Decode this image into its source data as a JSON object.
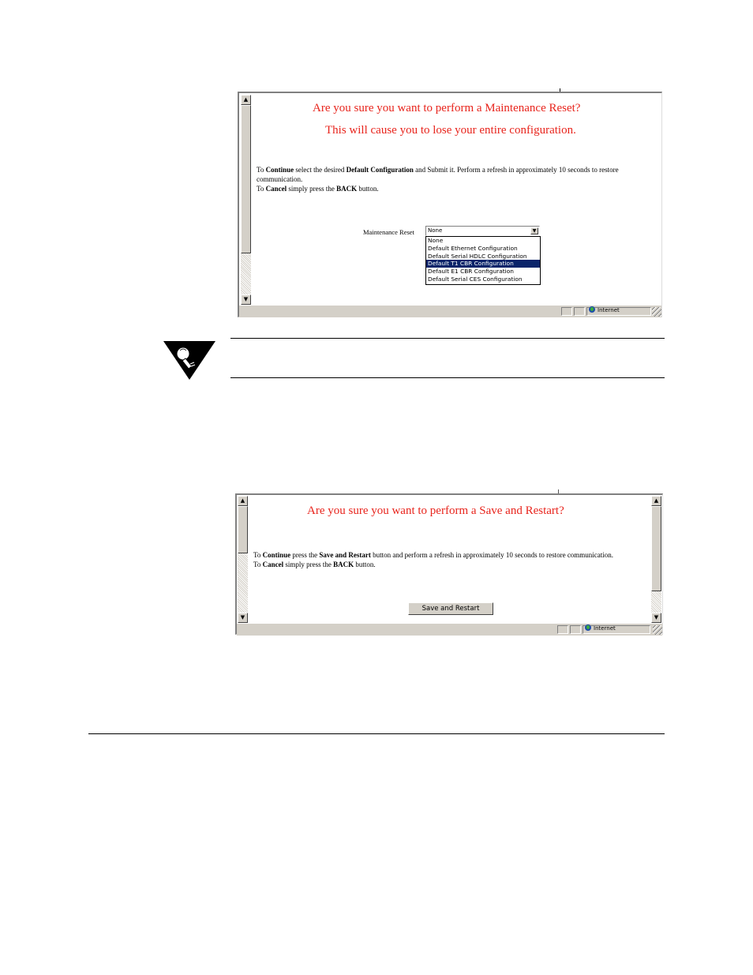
{
  "maintenance_window": {
    "heading_line1": "Are you sure you want to perform a Maintenance Reset?",
    "heading_line2": "This will cause you to lose your entire configuration.",
    "instr": {
      "p1_a": "To ",
      "p1_b": "Continue",
      "p1_c": " select the desired ",
      "p1_d": "Default Configuration",
      "p1_e": " and Submit it. Perform a refresh in approximately 10 seconds to restore communication.",
      "p2_a": "To ",
      "p2_b": "Cancel",
      "p2_c": " simply press the ",
      "p2_d": "BACK",
      "p2_e": " button."
    },
    "select_label": "Maintenance Reset",
    "select_value": "None",
    "options": [
      "None",
      "Default Ethernet Configuration",
      "Default Serial HDLC Configuration",
      "Default T1 CBR Configuration",
      "Default E1 CBR Configuration",
      "Default Serial CES Configuration"
    ],
    "highlighted_option_index": 3,
    "status_zone": "Internet"
  },
  "restart_window": {
    "heading": "Are you sure you want to perform a Save and Restart?",
    "instr": {
      "p1_a": "To ",
      "p1_b": "Continue",
      "p1_c": " press the ",
      "p1_d": "Save and Restart",
      "p1_e": " button and perform a refresh in approximately 10 seconds to restore communication.",
      "p2_a": "To ",
      "p2_b": "Cancel",
      "p2_c": " simply press the ",
      "p2_d": "BACK",
      "p2_e": " button."
    },
    "button_label": "Save and Restart",
    "status_zone": "Internet"
  },
  "colors": {
    "heading_red": "#e8241c",
    "selection_blue": "#0a246a",
    "chrome_gray": "#d4d0c8"
  },
  "icons": [
    "note-lightbulb-icon",
    "globe-icon",
    "scroll-up-arrow-icon",
    "scroll-down-arrow-icon",
    "dropdown-arrow-icon",
    "resize-grip-icon"
  ]
}
